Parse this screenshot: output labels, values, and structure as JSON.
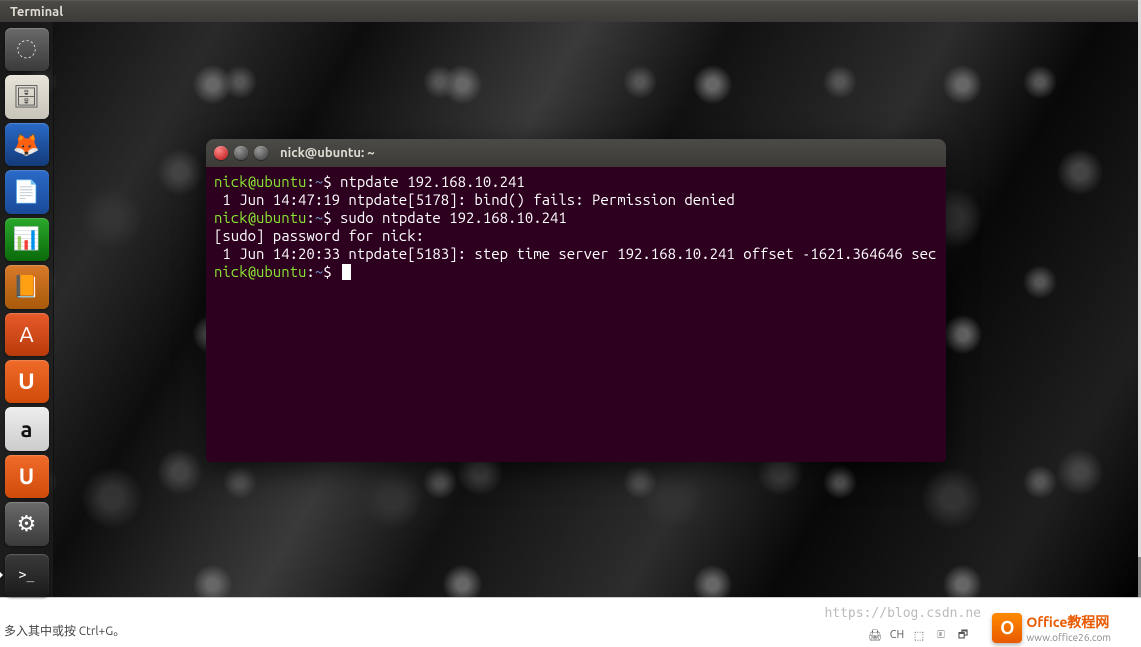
{
  "menubar": {
    "app_label": "Terminal"
  },
  "launcher": {
    "items": [
      {
        "name": "dash",
        "glyph": "◌",
        "cls": "li-dash"
      },
      {
        "name": "files",
        "glyph": "🗄",
        "cls": "li-home"
      },
      {
        "name": "firefox",
        "glyph": "🦊",
        "cls": "li-ff"
      },
      {
        "name": "writer",
        "glyph": "📄",
        "cls": "li-doc"
      },
      {
        "name": "calc",
        "glyph": "📊",
        "cls": "li-calc"
      },
      {
        "name": "impress",
        "glyph": "📙",
        "cls": "li-imp"
      },
      {
        "name": "software",
        "glyph": "A",
        "cls": "li-sw"
      },
      {
        "name": "ubuntu-one",
        "glyph": "U",
        "cls": "li-u1"
      },
      {
        "name": "amazon",
        "glyph": "a",
        "cls": "li-amz"
      },
      {
        "name": "ubuntu-one2",
        "glyph": "U",
        "cls": "li-u2"
      },
      {
        "name": "settings",
        "glyph": "⚙",
        "cls": "li-set"
      }
    ],
    "bottom": {
      "name": "terminal",
      "glyph": ">_",
      "cls": "li-term"
    }
  },
  "terminal": {
    "title": "nick@ubuntu: ~",
    "prompt": {
      "user": "nick@ubuntu",
      "sep": ":",
      "path": "~",
      "sym": "$"
    },
    "lines": {
      "cmd1": "ntpdate 192.168.10.241",
      "out1": " 1 Jun 14:47:19 ntpdate[5178]: bind() fails: Permission denied",
      "cmd2": "sudo ntpdate 192.168.10.241",
      "out2": "[sudo] password for nick:",
      "out3": " 1 Jun 14:20:33 ntpdate[5183]: step time server 192.168.10.241 offset -1621.364646 sec"
    }
  },
  "bottom": {
    "hint": "多入其中或按 Ctrl+G。",
    "watermark_url": "https://blog.csdn.ne",
    "logo_letter": "O",
    "logo_text1": "Office教程网",
    "logo_text2": "www.office26.com",
    "tray_ime": "CH"
  }
}
